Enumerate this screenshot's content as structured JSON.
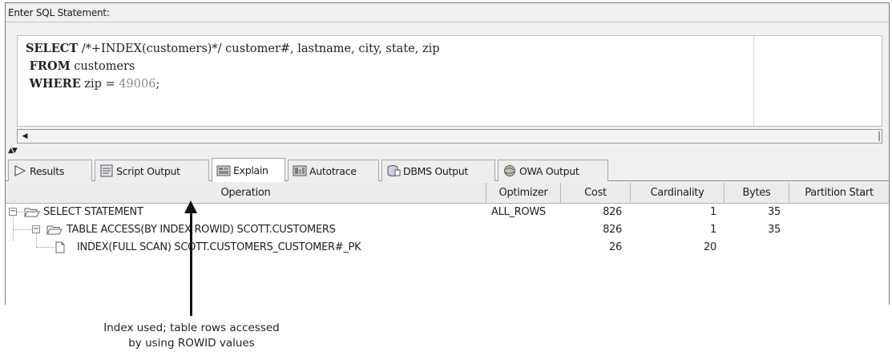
{
  "prompt_label": "Enter SQL Statement:",
  "sql": {
    "line1": {
      "keyword": "SELECT",
      "rest": " /*+INDEX(customers)*/ customer#, lastname, city, state, zip"
    },
    "line2": {
      "keyword": "FROM",
      "rest": " customers"
    },
    "line3": {
      "keyword": "WHERE",
      "rest": " zip = ",
      "number": "49006",
      "tail": ";"
    }
  },
  "tabs": [
    {
      "label": "Results",
      "icon": "play-icon"
    },
    {
      "label": "Script Output",
      "icon": "script-output-icon"
    },
    {
      "label": "Explain",
      "icon": "explain-plan-icon",
      "active": true
    },
    {
      "label": "Autotrace",
      "icon": "autotrace-icon"
    },
    {
      "label": "DBMS Output",
      "icon": "dbms-output-icon"
    },
    {
      "label": "OWA Output",
      "icon": "owa-output-icon"
    }
  ],
  "columns": [
    "Operation",
    "Optimizer",
    "Cost",
    "Cardinality",
    "Bytes",
    "Partition Start"
  ],
  "rows": [
    {
      "operation": "SELECT STATEMENT",
      "optimizer": "ALL_ROWS",
      "cost": "826",
      "cardinality": "1",
      "bytes": "35",
      "partition_start": ""
    },
    {
      "operation": "TABLE ACCESS(BY INDEX ROWID) SCOTT.CUSTOMERS",
      "optimizer": "",
      "cost": "826",
      "cardinality": "1",
      "bytes": "35",
      "partition_start": ""
    },
    {
      "operation": "INDEX(FULL SCAN) SCOTT.CUSTOMERS_CUSTOMER#_PK",
      "optimizer": "",
      "cost": "26",
      "cardinality": "20",
      "bytes": "",
      "partition_start": ""
    }
  ],
  "annotation": {
    "line1": "Index used; table rows accessed",
    "line2": "by using ROWID values"
  },
  "colors": {
    "folder": "#e8c66a",
    "tab_active": "#ffffff",
    "header_bg": "#ececec"
  }
}
